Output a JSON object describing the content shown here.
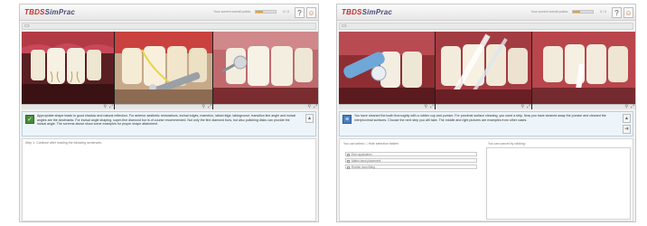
{
  "app": {
    "logo_prefix": "TBDS",
    "logo_suffix": "SimPrac"
  },
  "header": {
    "score_label": "Your current overall points:",
    "score_value": "0 / 0",
    "score_fraction": 0.35,
    "help_label": "?",
    "user_label": "☺"
  },
  "left": {
    "info_text": "Appropriate shape leads to good shadow and natural reflection. For anterior aesthetic restorations, incisal edges, mamelon, labial ridge, labiogroove, transition line angle and incisal angles are the landmarks. For incisal angle shaping, super-fine diamond bur is of course recommended. Not only the fine diamond burs, but also polishing disks can provide the incisal angle. The screens above show some examples for proper shape attainment.",
    "status_text": "Step 1: Continue after reading the following sentences."
  },
  "right": {
    "info_text": "You have cleaned the tooth thoroughly with a rubber cup and pumice. For proximal surface cleaning, you used a strip. Now you have cleaned away the pumice and cleaned the interproximal surfaces. Choose the next step you will take. The middle and right pictures are examples from other cases.",
    "left_col_head": "You can select:  □   Hide selection hidden",
    "right_col_head": "You can cancel by clicking:",
    "choices": [
      "Etch application",
      "Matrix band placement",
      "Rubber dam fitting"
    ]
  },
  "icons": {
    "collapse": "collapse-icon",
    "resize": "resize-icon",
    "magnify": "magnify-icon",
    "info": "check-icon",
    "next": "next-arrow-icon"
  }
}
